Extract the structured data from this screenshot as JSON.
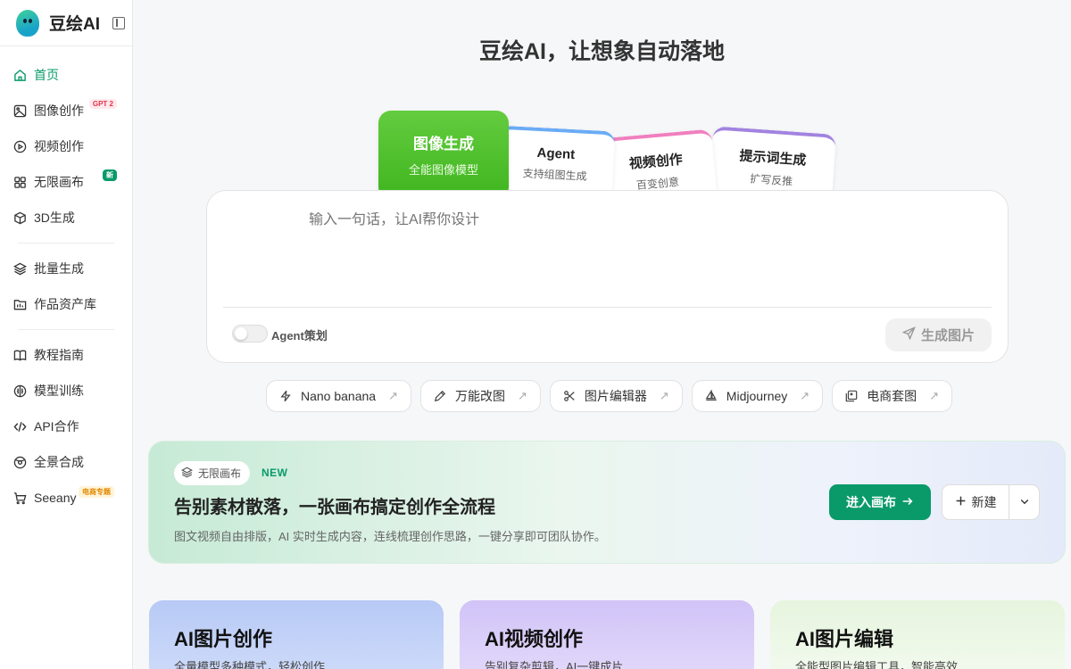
{
  "brand": {
    "name": "豆绘AI"
  },
  "sidebar": {
    "items": [
      {
        "label": "首页",
        "icon": "home-icon",
        "active": true
      },
      {
        "label": "图像创作",
        "icon": "image-icon",
        "badge": "GPT 2"
      },
      {
        "label": "视频创作",
        "icon": "play-circle-icon"
      },
      {
        "label": "无限画布",
        "icon": "grid-icon",
        "badge": "新"
      },
      {
        "label": "3D生成",
        "icon": "cube-icon"
      },
      {
        "label": "批量生成",
        "icon": "layers-icon"
      },
      {
        "label": "作品资产库",
        "icon": "folder-icon"
      },
      {
        "label": "教程指南",
        "icon": "book-icon"
      },
      {
        "label": "模型训练",
        "icon": "brain-icon"
      },
      {
        "label": "API合作",
        "icon": "code-icon"
      },
      {
        "label": "全景合成",
        "icon": "panorama-icon"
      },
      {
        "label": "Seeany",
        "icon": "cart-icon",
        "badge": "电商专题"
      }
    ]
  },
  "hero": {
    "title": "豆绘AI，让想象自动落地"
  },
  "modes": [
    {
      "title": "图像生成",
      "subtitle": "全能图像模型"
    },
    {
      "title": "Agent",
      "subtitle": "支持组图生成"
    },
    {
      "title": "视频创作",
      "subtitle": "百变创意"
    },
    {
      "title": "提示词生成",
      "subtitle": "扩写反推"
    }
  ],
  "prompt": {
    "placeholder": "输入一句话，让AI帮你设计",
    "agent_toggle_label": "Agent策划",
    "agent_toggle_on": false,
    "generate_label": "生成图片"
  },
  "tools": [
    {
      "label": "Nano banana",
      "icon": "bolt-icon"
    },
    {
      "label": "万能改图",
      "icon": "pen-icon"
    },
    {
      "label": "图片编辑器",
      "icon": "scissors-icon"
    },
    {
      "label": "Midjourney",
      "icon": "sailboat-icon"
    },
    {
      "label": "电商套图",
      "icon": "images-icon"
    }
  ],
  "banner": {
    "pill_label": "无限画布",
    "new_tag": "NEW",
    "title": "告别素材散落，一张画布搞定创作全流程",
    "description": "图文视频自由排版，AI 实时生成内容，连线梳理创作思路，一键分享即可团队协作。",
    "enter_label": "进入画布",
    "new_label": "新建"
  },
  "features": [
    {
      "title": "AI图片创作",
      "subtitle": "全量模型多种模式，轻松创作"
    },
    {
      "title": "AI视频创作",
      "subtitle": "告别复杂剪辑，AI一键成片"
    },
    {
      "title": "AI图片编辑",
      "subtitle": "全能型图片编辑工具，智能高效"
    }
  ],
  "colors": {
    "accent": "#0a9a6a",
    "image_card": "#52c02d"
  }
}
